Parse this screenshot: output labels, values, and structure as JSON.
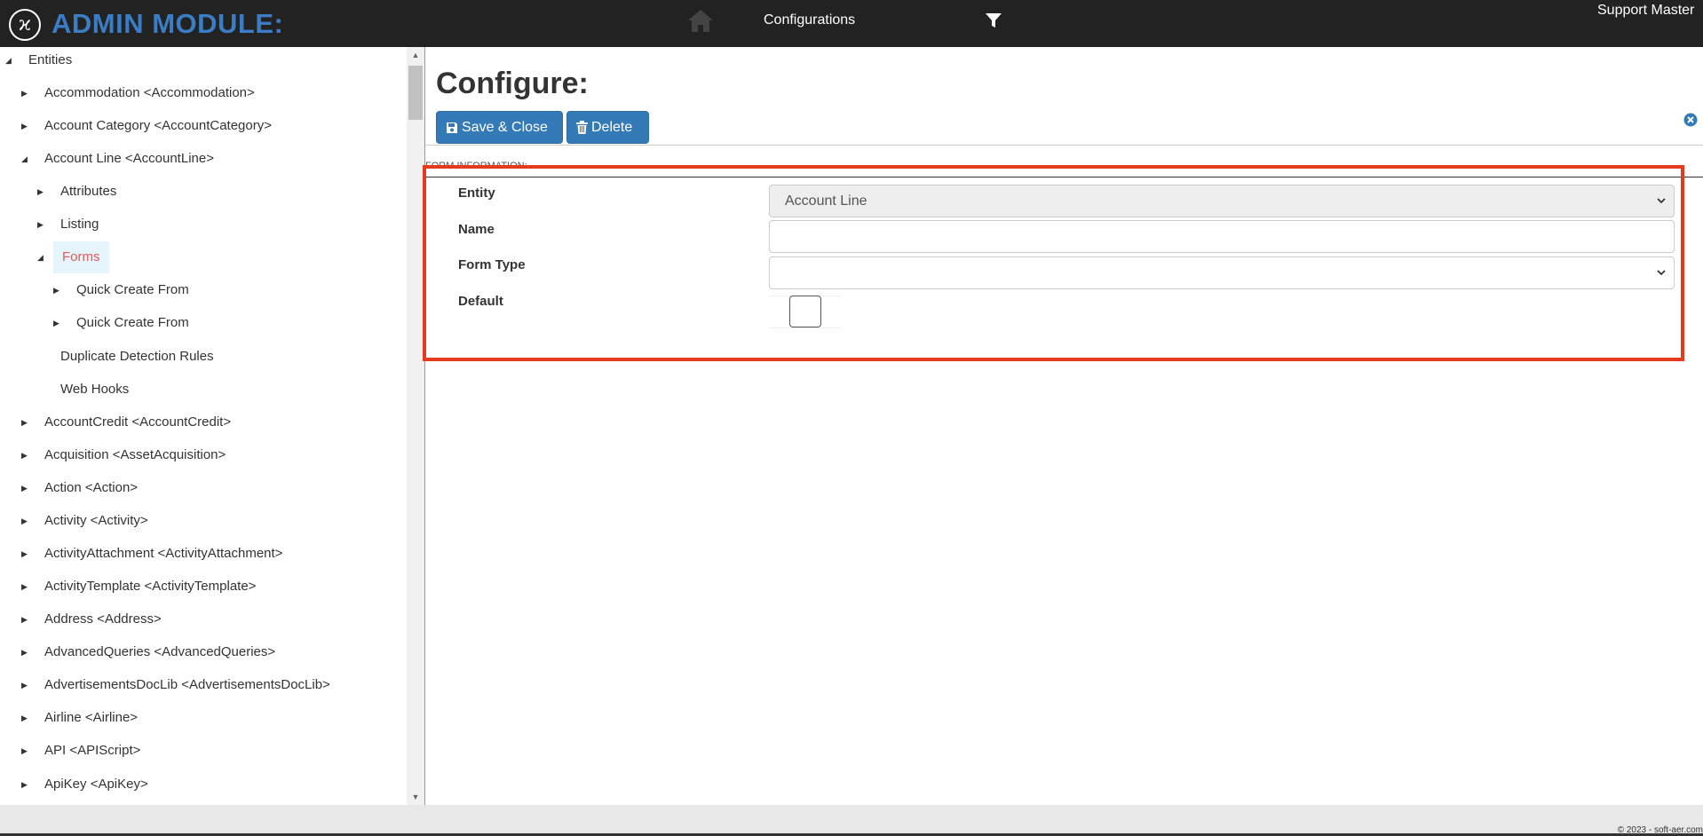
{
  "header": {
    "logo_glyph": "ϰ",
    "app_title": "ADMIN MODULE:",
    "nav_configurations": "Configurations",
    "user_name": "Support Master"
  },
  "sidebar": {
    "items": [
      {
        "label": "Entities",
        "toggle": "◢"
      },
      {
        "label": "Accommodation <Accommodation>",
        "toggle": "▶"
      },
      {
        "label": "Account Category <AccountCategory>",
        "toggle": "▶"
      },
      {
        "label": "Account Line <AccountLine>",
        "toggle": "◢"
      },
      {
        "label": "Attributes",
        "toggle": "▶"
      },
      {
        "label": "Listing",
        "toggle": "▶"
      },
      {
        "label": "Forms",
        "toggle": "◢"
      },
      {
        "label": "Quick Create From",
        "toggle": "▶"
      },
      {
        "label": "Quick Create From",
        "toggle": "▶"
      },
      {
        "label": "Duplicate Detection Rules",
        "toggle": ""
      },
      {
        "label": "Web Hooks",
        "toggle": ""
      },
      {
        "label": "AccountCredit <AccountCredit>",
        "toggle": "▶"
      },
      {
        "label": "Acquisition <AssetAcquisition>",
        "toggle": "▶"
      },
      {
        "label": "Action <Action>",
        "toggle": "▶"
      },
      {
        "label": "Activity <Activity>",
        "toggle": "▶"
      },
      {
        "label": "ActivityAttachment <ActivityAttachment>",
        "toggle": "▶"
      },
      {
        "label": "ActivityTemplate <ActivityTemplate>",
        "toggle": "▶"
      },
      {
        "label": "Address <Address>",
        "toggle": "▶"
      },
      {
        "label": "AdvancedQueries <AdvancedQueries>",
        "toggle": "▶"
      },
      {
        "label": "AdvertisementsDocLib <AdvertisementsDocLib>",
        "toggle": "▶"
      },
      {
        "label": "Airline <Airline>",
        "toggle": "▶"
      },
      {
        "label": "API <APIScript>",
        "toggle": "▶"
      },
      {
        "label": "ApiKey <ApiKey>",
        "toggle": "▶"
      }
    ],
    "active_item": "Forms"
  },
  "main": {
    "title": "Configure:",
    "save_close_label": "Save & Close",
    "delete_label": "Delete",
    "section_label": "FORM INFORMATION:",
    "fields": {
      "entity_label": "Entity",
      "entity_value": "Account Line",
      "name_label": "Name",
      "name_value": "",
      "form_type_label": "Form Type",
      "form_type_value": "",
      "default_label": "Default",
      "default_checked": false
    }
  },
  "footer": {
    "copyright": "© 2023 - soft-aer.com"
  },
  "colors": {
    "topbar": "#222222",
    "brand_blue": "#3a7dc4",
    "button_blue": "#337ab7",
    "active_text": "#e4595b",
    "highlight_red": "#e43a1e"
  }
}
